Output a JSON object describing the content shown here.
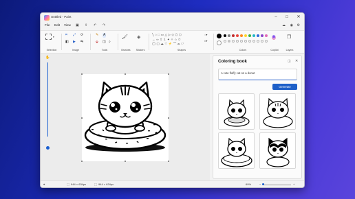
{
  "window": {
    "title": "Untitled - Paint"
  },
  "menu": {
    "file": "File",
    "edit": "Edit",
    "view": "View"
  },
  "ribbon": {
    "groups": {
      "selection": "Selection",
      "image": "Image",
      "tools": "Tools",
      "brushes": "Brushes",
      "stickers": "Stickers",
      "shapes": "Shapes",
      "colors": "Colors",
      "copilot": "Copilot",
      "layers": "Layers"
    },
    "palette_row1": [
      "#000000",
      "#7f7f7f",
      "#c02b2b",
      "#e8453c",
      "#ff8a1e",
      "#ffd52a",
      "#3cb043",
      "#20b5c7",
      "#2e6bdc",
      "#8a43c9",
      "#e16bb7"
    ],
    "palette_row2": [
      "#ffffff",
      "#c3c3c3",
      "#ffffff",
      "#ffffff",
      "#ffffff",
      "#ffffff",
      "#ffffff",
      "#ffffff",
      "#ffffff",
      "#ffffff",
      "#ffffff"
    ]
  },
  "panel": {
    "title": "Coloring book",
    "prompt": "A cute fluffy cat on a donut",
    "generate_label": "Generate"
  },
  "status": {
    "canvas_size": "944 × 634px",
    "selection_size": "944 × 634px",
    "zoom": "69%"
  }
}
